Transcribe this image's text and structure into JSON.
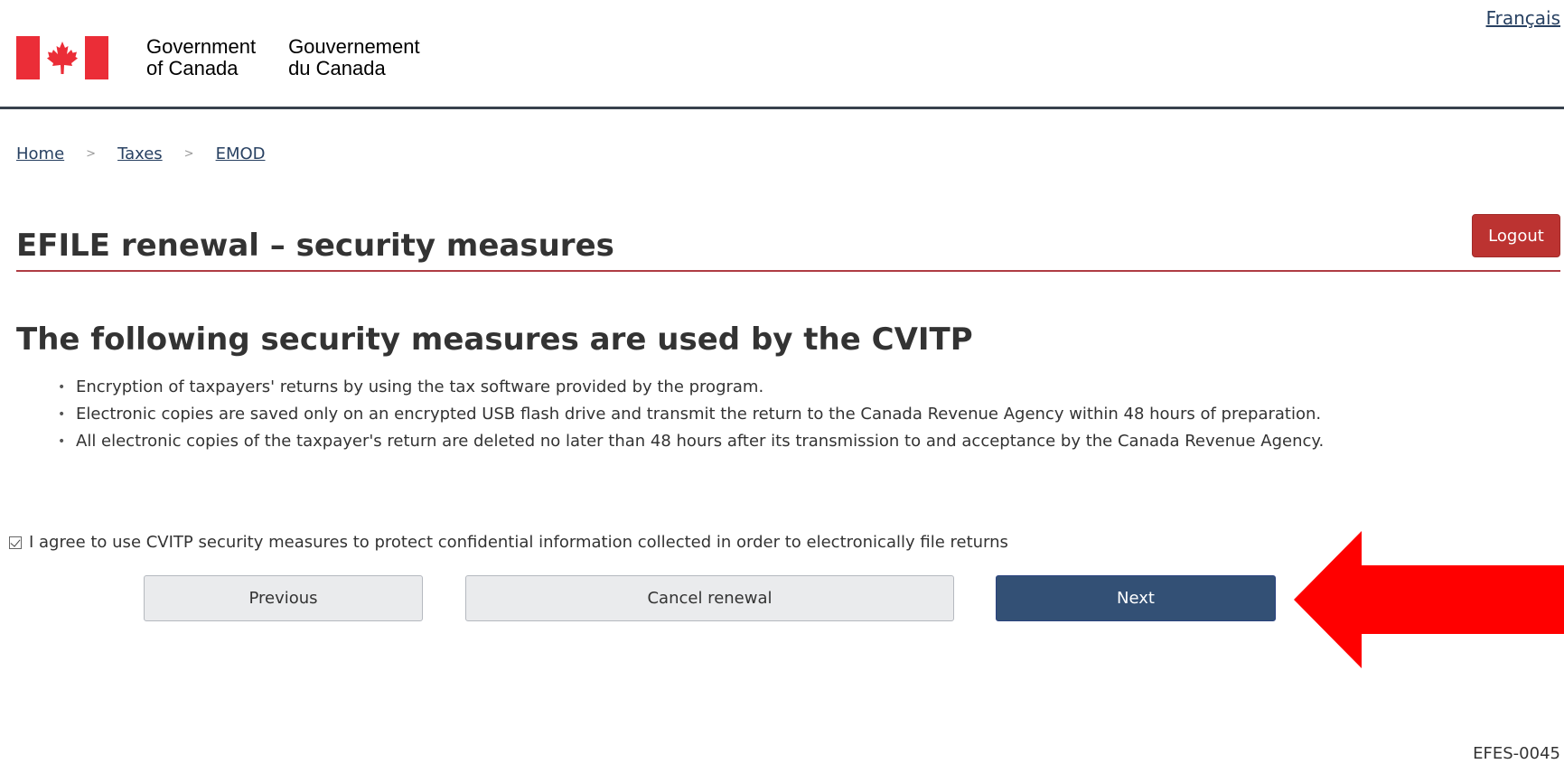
{
  "header": {
    "language_link": "Français",
    "signature_en_line1": "Government",
    "signature_en_line2": "of Canada",
    "signature_fr_line1": "Gouvernement",
    "signature_fr_line2": "du Canada"
  },
  "breadcrumb": {
    "items": [
      "Home",
      "Taxes",
      "EMOD"
    ]
  },
  "logout_label": "Logout",
  "page_title": "EFILE renewal – security measures",
  "section_heading": "The following security measures are used by the CVITP",
  "measures": [
    "Encryption of taxpayers' returns by using the tax software provided by the program.",
    "Electronic copies are saved only on an encrypted USB flash drive and transmit the return to the Canada Revenue Agency within 48 hours of preparation.",
    "All electronic copies of the taxpayer's return are deleted no later than 48 hours after its transmission to and acceptance by the Canada Revenue Agency."
  ],
  "agreement": {
    "label": "I agree to use CVITP security measures to protect confidential information collected in order to electronically file returns",
    "checked": true
  },
  "buttons": {
    "previous": "Previous",
    "cancel": "Cancel renewal",
    "next": "Next"
  },
  "page_id": "EFES-0045",
  "colors": {
    "flag_red": "#eb2d37",
    "logout_red": "#bc3331",
    "next_blue": "#335075",
    "title_rule": "#af3c43",
    "annotation_arrow": "#ff0000"
  }
}
